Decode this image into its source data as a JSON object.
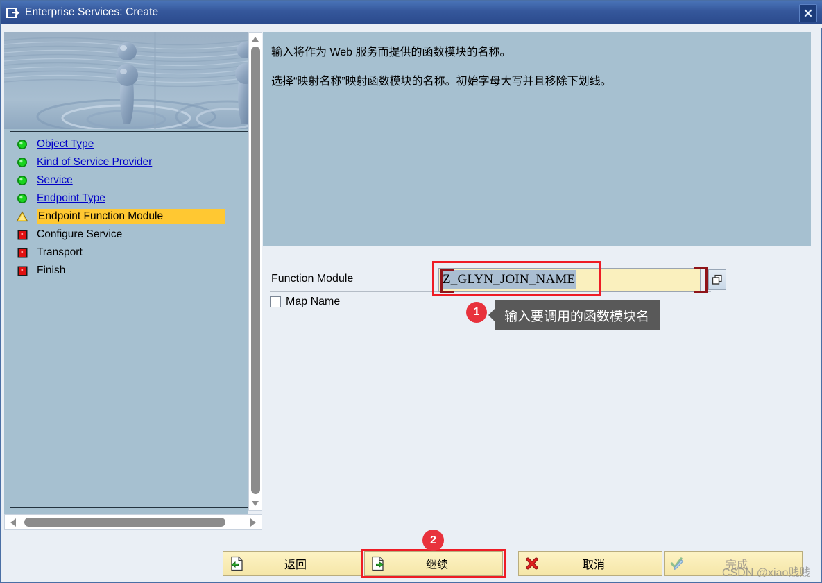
{
  "window": {
    "title": "Enterprise Services: Create",
    "title_icon": "window-export-icon",
    "close_icon": "close-x-icon"
  },
  "sidebar": {
    "banner_icon": "water-droplet-splash-image",
    "items": [
      {
        "label": "Object Type",
        "status": "done",
        "icon": "green-circle-icon"
      },
      {
        "label": "Kind of Service Provider",
        "status": "done",
        "icon": "green-circle-icon"
      },
      {
        "label": "Service",
        "status": "done",
        "icon": "green-circle-icon"
      },
      {
        "label": "Endpoint Type",
        "status": "done",
        "icon": "green-circle-icon"
      },
      {
        "label": "Endpoint Function Module",
        "status": "current",
        "icon": "yellow-warning-triangle-icon"
      },
      {
        "label": "Configure Service",
        "status": "pending",
        "icon": "red-square-icon"
      },
      {
        "label": "Transport",
        "status": "pending",
        "icon": "red-square-icon"
      },
      {
        "label": "Finish",
        "status": "pending",
        "icon": "red-square-icon"
      }
    ],
    "scrollbar": {
      "up_icon": "triangle-up-icon",
      "down_icon": "triangle-down-icon",
      "left_icon": "triangle-left-icon",
      "right_icon": "triangle-right-icon"
    }
  },
  "instructions": {
    "line1": "输入将作为 Web 服务而提供的函数模块的名称。",
    "line2": "选择“映射名称”映射函数模块的名称。初始字母大写并且移除下划线。"
  },
  "form": {
    "function_module": {
      "label": "Function Module",
      "value": "Z_GLYN_JOIN_NAME",
      "placeholder": "",
      "help_icon": "value-help-icon"
    },
    "map_name": {
      "label": "Map Name",
      "checked": false
    }
  },
  "annotations": {
    "badge1": "1",
    "tooltip1": "输入要调用的函数模块名",
    "badge2": "2",
    "highlight_color": "#ee1c25",
    "badge_color": "#e8323c",
    "tooltip_bg": "#595959"
  },
  "buttons": {
    "back": {
      "label": "返回",
      "icon": "document-back-arrow-icon",
      "enabled": true
    },
    "continue": {
      "label": "继续",
      "icon": "document-forward-arrow-icon",
      "enabled": true
    },
    "cancel": {
      "label": "取消",
      "icon": "red-x-icon",
      "enabled": true
    },
    "finish": {
      "label": "完成",
      "icon": "check-pencil-icon",
      "enabled": false
    }
  },
  "watermark": "CSDN @xiao贱贱"
}
